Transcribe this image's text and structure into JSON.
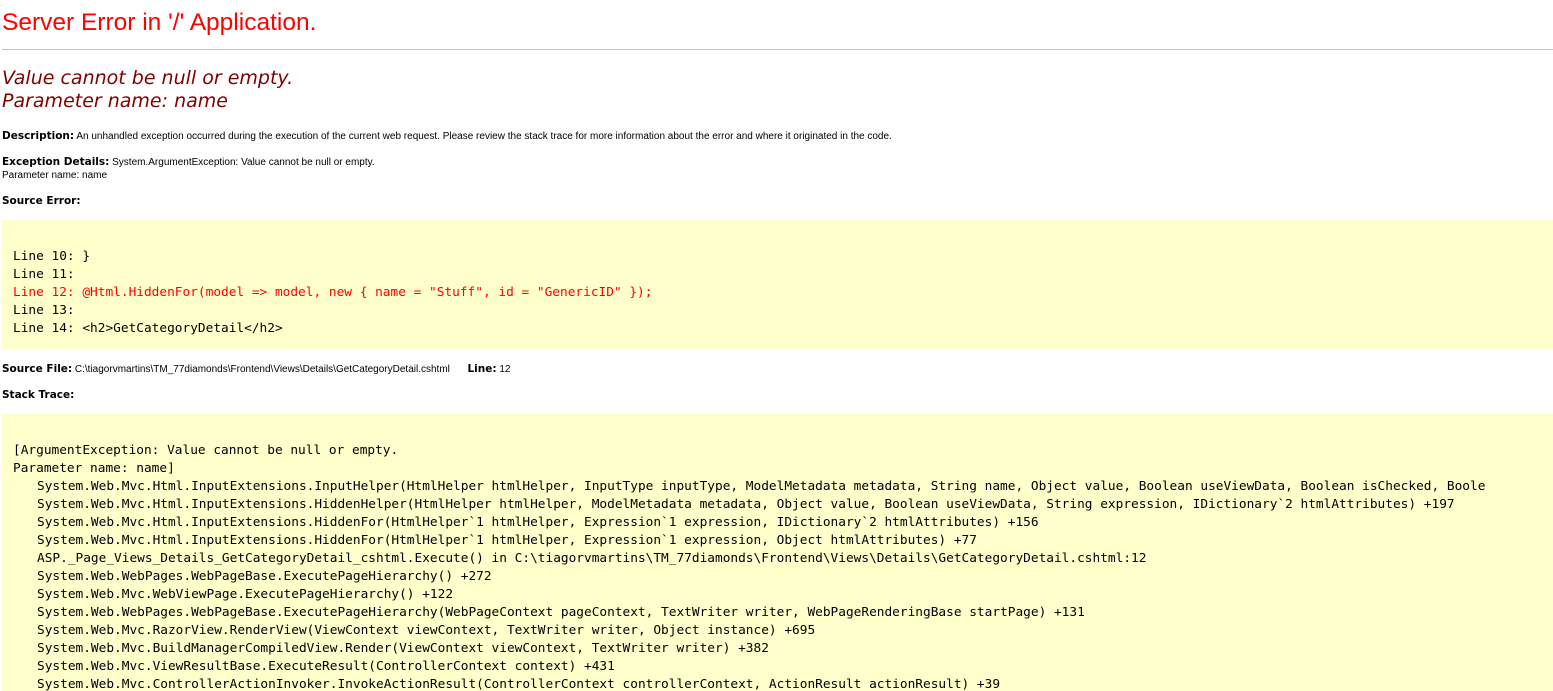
{
  "title": "Server Error in '/' Application.",
  "error_message": "Value cannot be null or empty.",
  "parameter_line": "Parameter name: name",
  "description": {
    "label": "Description:",
    "text": "An unhandled exception occurred during the execution of the current web request. Please review the stack trace for more information about the error and where it originated in the code."
  },
  "exception_details": {
    "label": "Exception Details:",
    "text": "System.ArgumentException: Value cannot be null or empty.",
    "text2": "Parameter name: name"
  },
  "source_error": {
    "label": "Source Error:",
    "lines": [
      "Line 10: }",
      "Line 11:",
      "Line 12: @Html.HiddenFor(model => model, new { name = \"Stuff\", id = \"GenericID\" });",
      "Line 13:",
      "Line 14: <h2>GetCategoryDetail</h2>"
    ],
    "highlight_index": 2
  },
  "source_file": {
    "label": "Source File:",
    "path": "C:\\tiagorvmartins\\TM_77diamonds\\Frontend\\Views\\Details\\GetCategoryDetail.cshtml",
    "line_label": "Line:",
    "line_number": "12"
  },
  "stack_trace": {
    "label": "Stack Trace:",
    "header": [
      "[ArgumentException: Value cannot be null or empty.",
      "Parameter name: name]"
    ],
    "frames": [
      "System.Web.Mvc.Html.InputExtensions.InputHelper(HtmlHelper htmlHelper, InputType inputType, ModelMetadata metadata, String name, Object value, Boolean useViewData, Boolean isChecked, Boole",
      "System.Web.Mvc.Html.InputExtensions.HiddenHelper(HtmlHelper htmlHelper, ModelMetadata metadata, Object value, Boolean useViewData, String expression, IDictionary`2 htmlAttributes) +197",
      "System.Web.Mvc.Html.InputExtensions.HiddenFor(HtmlHelper`1 htmlHelper, Expression`1 expression, IDictionary`2 htmlAttributes) +156",
      "System.Web.Mvc.Html.InputExtensions.HiddenFor(HtmlHelper`1 htmlHelper, Expression`1 expression, Object htmlAttributes) +77",
      "ASP._Page_Views_Details_GetCategoryDetail_cshtml.Execute() in C:\\tiagorvmartins\\TM_77diamonds\\Frontend\\Views\\Details\\GetCategoryDetail.cshtml:12",
      "System.Web.WebPages.WebPageBase.ExecutePageHierarchy() +272",
      "System.Web.Mvc.WebViewPage.ExecutePageHierarchy() +122",
      "System.Web.WebPages.WebPageBase.ExecutePageHierarchy(WebPageContext pageContext, TextWriter writer, WebPageRenderingBase startPage) +131",
      "System.Web.Mvc.RazorView.RenderView(ViewContext viewContext, TextWriter writer, Object instance) +695",
      "System.Web.Mvc.BuildManagerCompiledView.Render(ViewContext viewContext, TextWriter writer) +382",
      "System.Web.Mvc.ViewResultBase.ExecuteResult(ControllerContext context) +431",
      "System.Web.Mvc.ControllerActionInvoker.InvokeActionResult(ControllerContext controllerContext, ActionResult actionResult) +39"
    ]
  },
  "colors": {
    "title": "#ff0000",
    "subtitle": "#800000",
    "code_background": "#ffffcc",
    "highlight_line": "#ff0000",
    "rule": "#c0c0c0"
  }
}
